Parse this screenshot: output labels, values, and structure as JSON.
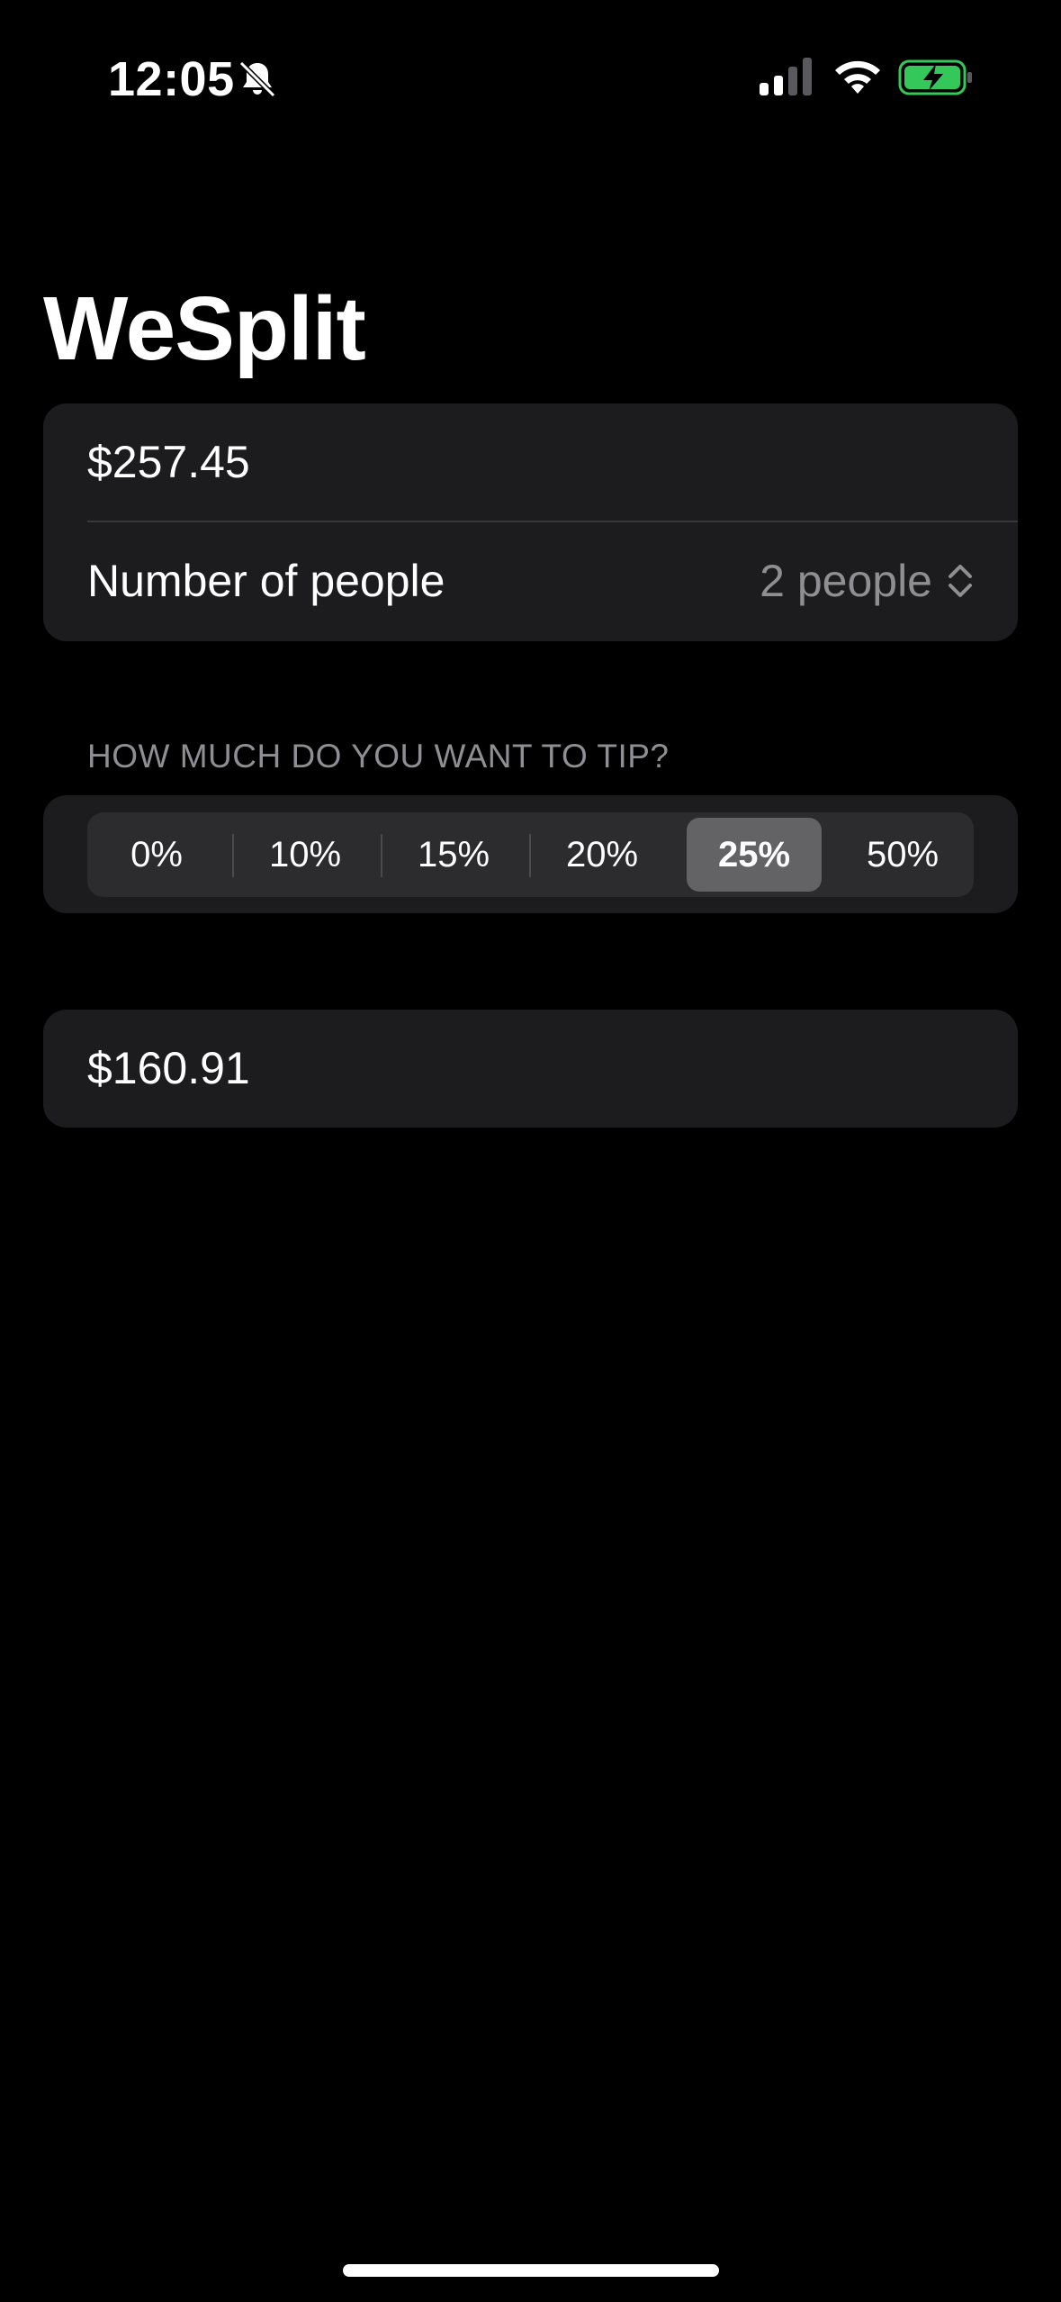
{
  "status_bar": {
    "time": "12:05",
    "icons": [
      "bell-slash-icon",
      "cellular-signal-icon",
      "wifi-icon",
      "battery-charging-icon"
    ],
    "battery_color": "#34c759"
  },
  "app": {
    "title": "WeSplit"
  },
  "input_section": {
    "check_amount": "$257.45",
    "people_label": "Number of people",
    "people_value": "2 people"
  },
  "tip_section": {
    "header": "HOW MUCH DO YOU WANT TO TIP?",
    "options": [
      "0%",
      "10%",
      "15%",
      "20%",
      "25%",
      "50%"
    ],
    "selected": "25%"
  },
  "result_section": {
    "amount_per_person": "$160.91"
  },
  "colors": {
    "background": "#000000",
    "card": "#1c1c1e",
    "secondary_text": "#8e8e93",
    "selected_segment": "#636366"
  }
}
